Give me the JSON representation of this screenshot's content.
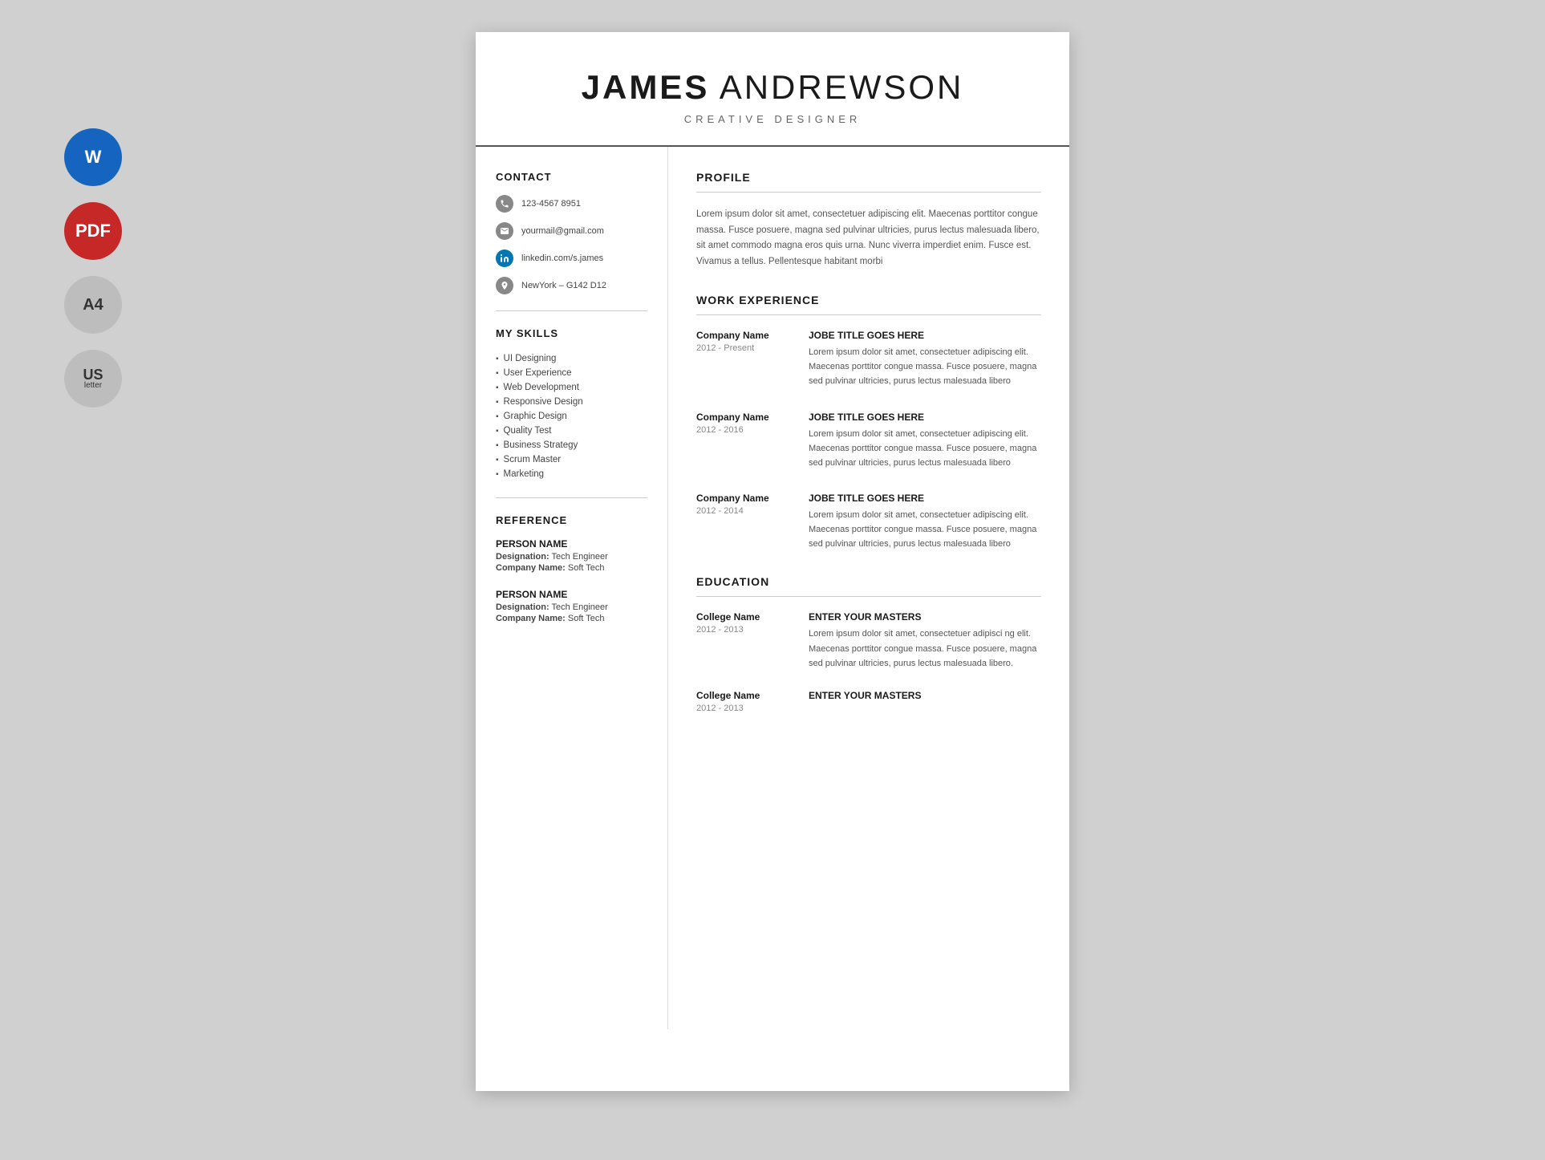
{
  "header": {
    "first_name": "JAMES",
    "last_name": "ANDREWSON",
    "title": "CREATIVE DESIGNER"
  },
  "sidebar_icons": [
    {
      "id": "word",
      "label": "W",
      "sub": "",
      "color": "#1565c0"
    },
    {
      "id": "pdf",
      "label": "PDF",
      "sub": "",
      "color": "#c62828"
    },
    {
      "id": "a4",
      "label": "A4",
      "sub": "",
      "color": "#bdbdbd"
    },
    {
      "id": "us",
      "label": "US",
      "sub": "letter",
      "color": "#bdbdbd"
    }
  ],
  "contact": {
    "section_title": "CONTACT",
    "phone": "123-4567 8951",
    "email": "yourmail@gmail.com",
    "linkedin": "linkedin.com/s.james",
    "address": "NewYork – G142 D12"
  },
  "skills": {
    "section_title": "MY SKILLS",
    "items": [
      "UI Designing",
      "User Experience",
      "Web Development",
      "Responsive Design",
      "Graphic Design",
      "Quality Test",
      "Business Strategy",
      "Scrum Master",
      "Marketing"
    ]
  },
  "reference": {
    "section_title": "REFERENCE",
    "persons": [
      {
        "name": "PERSON NAME",
        "designation_label": "Designation:",
        "designation_value": "Tech Engineer",
        "company_label": "Company Name:",
        "company_value": "Soft Tech"
      },
      {
        "name": "PERSON NAME",
        "designation_label": "Designation:",
        "designation_value": "Tech Engineer",
        "company_label": "Company Name:",
        "company_value": "Soft Tech"
      }
    ]
  },
  "profile": {
    "section_title": "PROFILE",
    "text": "Lorem ipsum dolor sit amet, consectetuer adipiscing elit. Maecenas porttitor congue massa. Fusce posuere, magna sed pulvinar ultricies, purus lectus malesuada libero, sit amet commodo magna eros quis urna. Nunc viverra imperdiet enim. Fusce est. Vivamus a tellus. Pellentesque habitant morbi"
  },
  "work_experience": {
    "section_title": "WORK EXPERIENCE",
    "entries": [
      {
        "company": "Company Name",
        "dates": "2012 - Present",
        "job_title": "JOBE TITLE GOES HERE",
        "description": "Lorem ipsum dolor sit amet, consectetuer adipiscing elit. Maecenas porttitor congue massa. Fusce posuere, magna sed pulvinar ultricies, purus lectus malesuada libero"
      },
      {
        "company": "Company Name",
        "dates": "2012 - 2016",
        "job_title": "JOBE TITLE GOES HERE",
        "description": "Lorem ipsum dolor sit amet, consectetuer adipiscing elit. Maecenas porttitor congue massa. Fusce posuere, magna sed pulvinar ultricies, purus lectus malesuada libero"
      },
      {
        "company": "Company Name",
        "dates": "2012 - 2014",
        "job_title": "JOBE TITLE GOES HERE",
        "description": "Lorem ipsum dolor sit amet, consectetuer adipiscing elit. Maecenas porttitor congue massa. Fusce posuere, magna sed pulvinar ultricies, purus lectus malesuada libero"
      }
    ]
  },
  "education": {
    "section_title": "EDUCATION",
    "entries": [
      {
        "college": "College Name",
        "dates": "2012 - 2013",
        "degree": "ENTER YOUR MASTERS",
        "description": "Lorem ipsum dolor sit amet, consectetuer adipiscing elit. Maecenas porttitor congue massa. Fusce posuere, magna sed pulvinar ultricies, purus lectus malesuada libero"
      },
      {
        "college": "College Name",
        "dates": "2012 - 2013",
        "degree": "ENTER YOUR MASTERS",
        "description": ""
      }
    ]
  }
}
